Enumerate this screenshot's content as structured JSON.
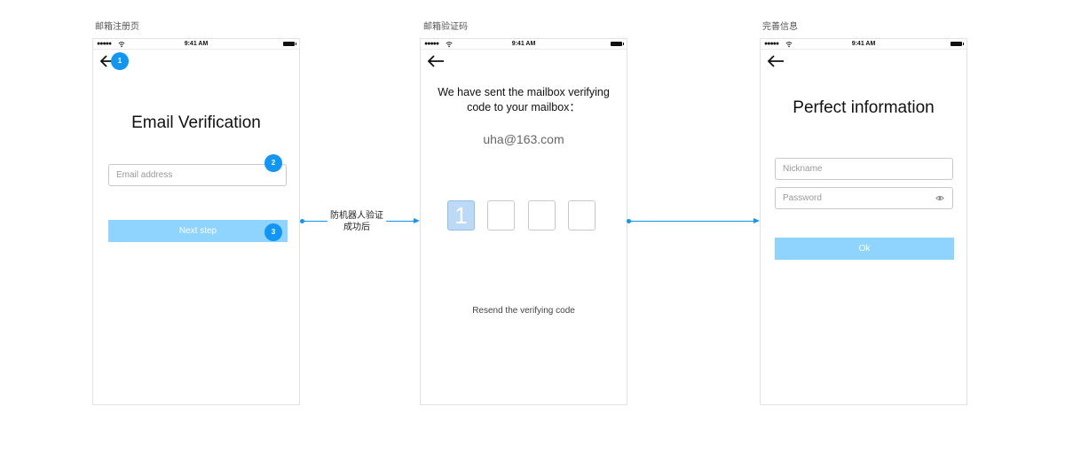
{
  "status_bar": {
    "signal": "●●●●●",
    "time": "9:41 AM"
  },
  "screens": [
    {
      "title": "邮箱注册页",
      "heading": "Email Verification",
      "email_placeholder": "Email address",
      "next_label": "Next step",
      "badges": [
        "1",
        "2",
        "3"
      ]
    },
    {
      "title": "邮箱验证码",
      "message_line1": "We have sent the mailbox verifying",
      "message_line2": "code to your mailbox：",
      "email": "uha@163.com",
      "code_digits": [
        "1",
        "",
        "",
        ""
      ],
      "resend_label": "Resend the verifying code"
    },
    {
      "title": "完善信息",
      "heading": "Perfect information",
      "nickname_placeholder": "Nickname",
      "password_placeholder": "Password",
      "ok_label": "Ok"
    }
  ],
  "flow": {
    "label_line1": "防机器人验证",
    "label_line2": "成功后"
  },
  "colors": {
    "accent": "#1296f3",
    "button": "#8fd3ff",
    "code_filled": "#bcd9f5"
  },
  "icons": [
    "back-arrow-icon",
    "wifi-icon",
    "battery-icon",
    "eye-icon"
  ]
}
